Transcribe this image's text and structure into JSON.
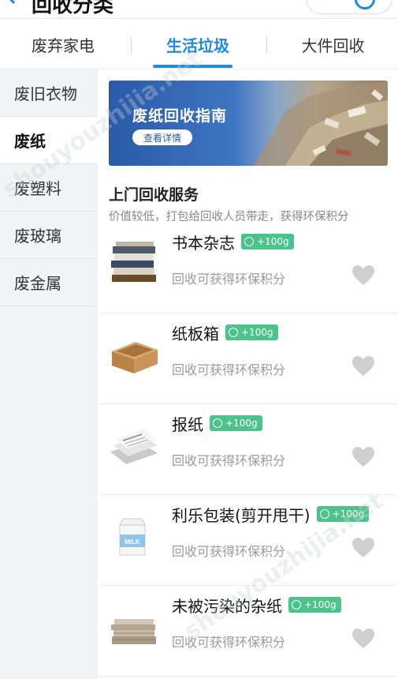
{
  "header": {
    "title": "回收分类"
  },
  "tabs": [
    {
      "label": "废弃家电"
    },
    {
      "label": "生活垃圾"
    },
    {
      "label": "大件回收"
    }
  ],
  "sidebar": {
    "items": [
      {
        "label": "废旧衣物"
      },
      {
        "label": "废纸"
      },
      {
        "label": "废塑料"
      },
      {
        "label": "废玻璃"
      },
      {
        "label": "废金属"
      }
    ]
  },
  "banner": {
    "title": "废纸回收指南",
    "button": "查看详情"
  },
  "section": {
    "title": "上门回收服务",
    "subtitle": "价值较低，打包给回收人员带走，获得环保积分"
  },
  "items": [
    {
      "name": "书本杂志",
      "badge": "+100g",
      "sub": "回收可获得环保积分",
      "icon": "books-icon"
    },
    {
      "name": "纸板箱",
      "badge": "+100g",
      "sub": "回收可获得环保积分",
      "icon": "cardboard-box-icon"
    },
    {
      "name": "报纸",
      "badge": "+100g",
      "sub": "回收可获得环保积分",
      "icon": "newspaper-icon"
    },
    {
      "name": "利乐包装(剪开甩干)",
      "badge": "+100g",
      "sub": "回收可获得环保积分",
      "icon": "milk-carton-icon",
      "carton_label": "MILK"
    },
    {
      "name": "未被污染的杂纸",
      "badge": "+100g",
      "sub": "回收可获得环保积分",
      "icon": "paper-stack-icon"
    }
  ],
  "watermark": [
    "shouyouzhijia.net",
    "shouyouzhijia.net"
  ],
  "colors": {
    "accent": "#1e88e5",
    "badge": "#4cc38a",
    "sidebar_bg": "#f2f3f5"
  }
}
